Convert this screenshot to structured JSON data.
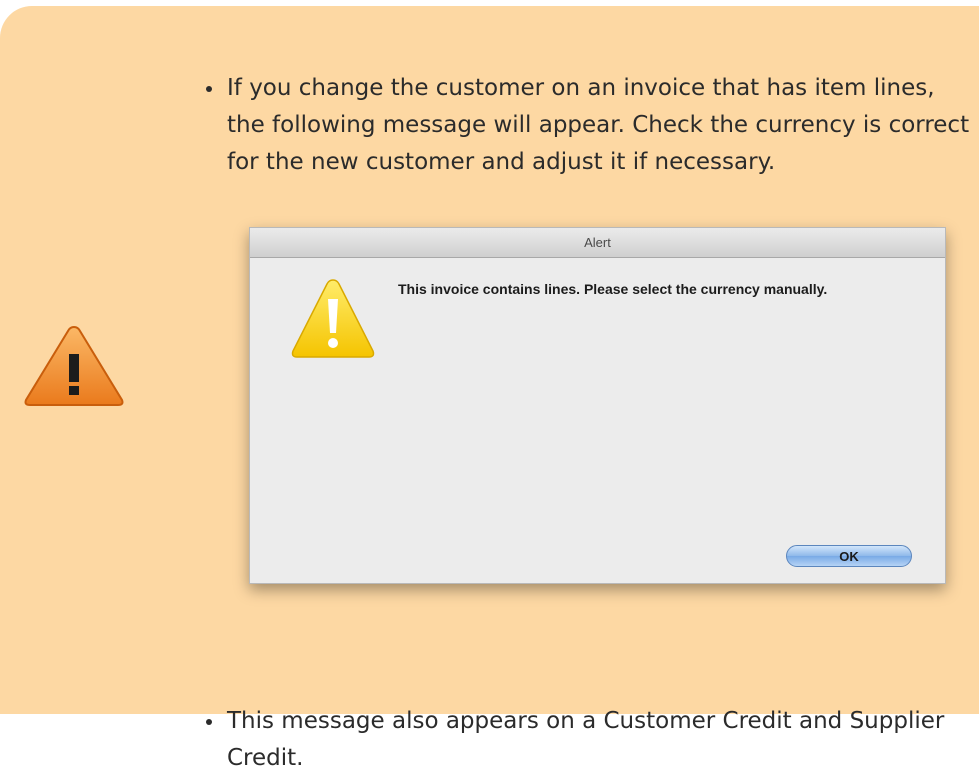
{
  "note": {
    "bullets": [
      "If you change the customer on an invoice that has item lines, the following message will appear. Check the currency is correct for the new customer and adjust it if necessary.",
      "This message also appears on a Customer Credit and Supplier Credit."
    ]
  },
  "dialog": {
    "title": "Alert",
    "message": "This invoice contains lines. Please select the currency manually.",
    "ok_label": "OK"
  },
  "colors": {
    "note_background": "#fdd8a3",
    "warning_orange": "#f08a24",
    "alert_yellow": "#ffd21f",
    "ok_button_blue": "#8fb9ea"
  },
  "icons": {
    "note_icon": "warning-icon",
    "dialog_icon": "alert-warning-icon"
  }
}
